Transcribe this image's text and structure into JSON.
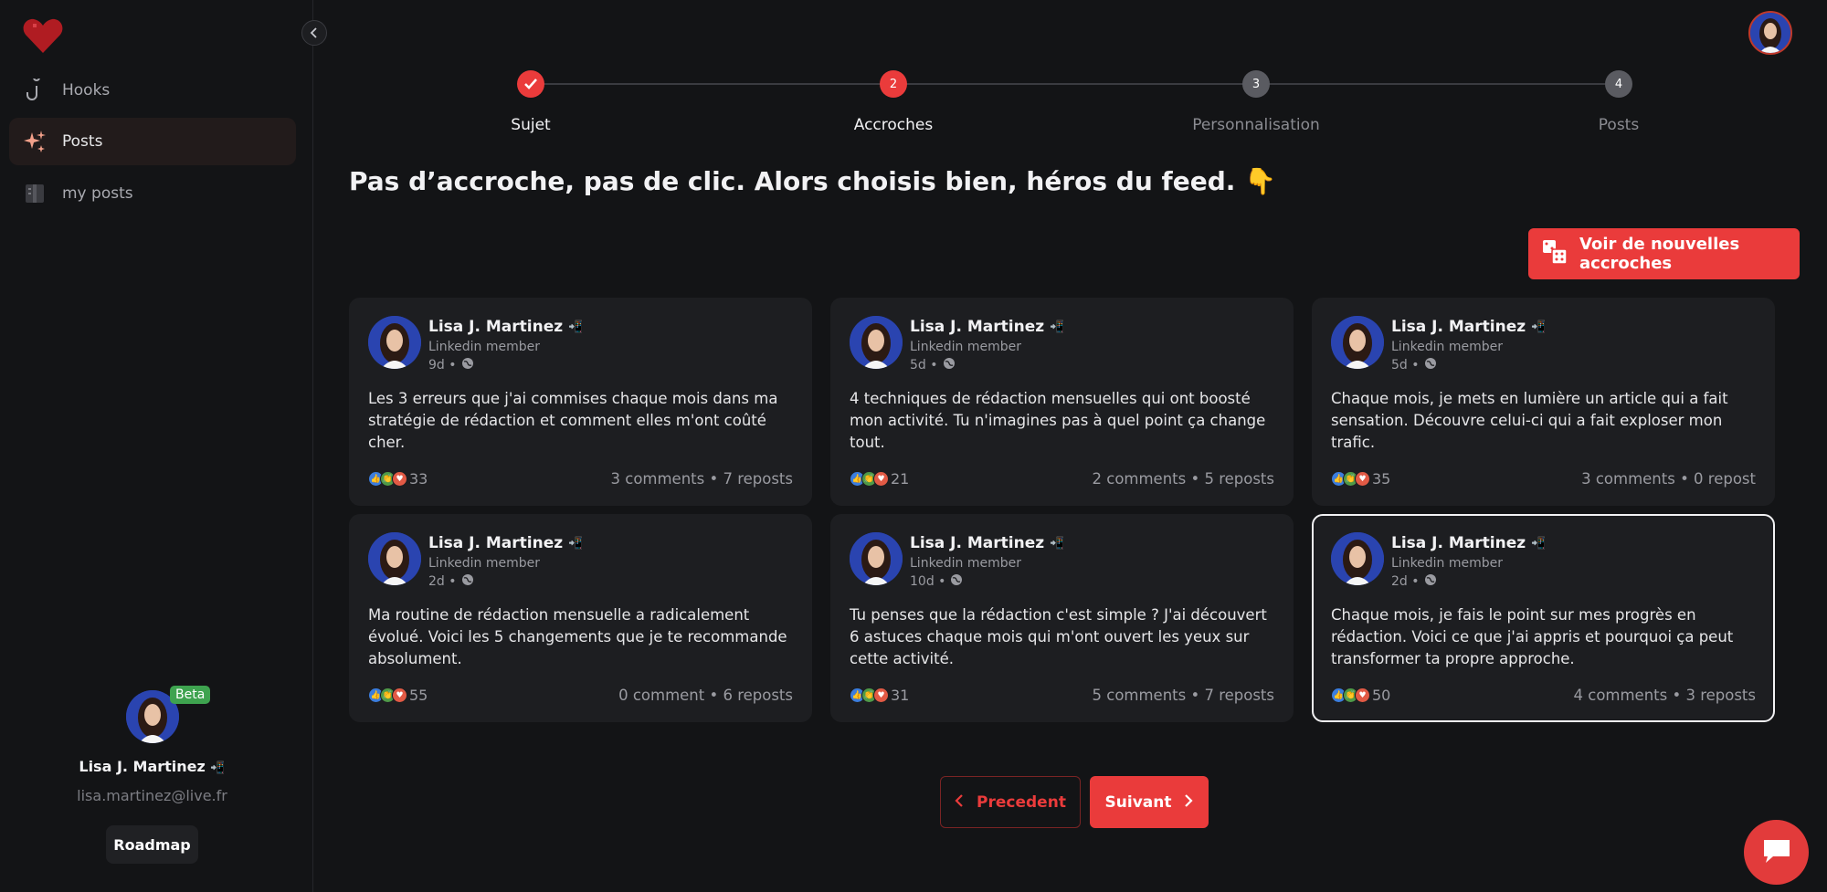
{
  "sidebar": {
    "items": [
      {
        "label": "Hooks",
        "icon": "hook-icon"
      },
      {
        "label": "Posts",
        "icon": "sparkles-icon"
      },
      {
        "label": "my posts",
        "icon": "notebook-icon"
      }
    ],
    "profile": {
      "badge": "Beta",
      "name": "Lisa J. Martinez",
      "email": "lisa.martinez@live.fr",
      "roadmap_label": "Roadmap"
    }
  },
  "stepper": {
    "steps": [
      {
        "number": "✓",
        "label": "Sujet",
        "state": "done"
      },
      {
        "number": "2",
        "label": "Accroches",
        "state": "active"
      },
      {
        "number": "3",
        "label": "Personnalisation",
        "state": "pending"
      },
      {
        "number": "4",
        "label": "Posts",
        "state": "pending"
      }
    ]
  },
  "main": {
    "title": "Pas d’accroche, pas de clic. Alors choisis bien, héros du feed. 👇",
    "new_hooks_label": "Voir de nouvelles accroches"
  },
  "posts": [
    {
      "name": "Lisa J. Martinez",
      "subtitle": "Linkedin member",
      "time": "9d •",
      "text": "Les 3 erreurs que j'ai commises chaque mois dans ma stratégie de rédaction et comment elles m'ont coûté cher.",
      "reactions": "33",
      "stats": "3 comments • 7 reposts"
    },
    {
      "name": "Lisa J. Martinez",
      "subtitle": "Linkedin member",
      "time": "5d •",
      "text": "4 techniques de rédaction mensuelles qui ont boosté mon activité. Tu n'imagines pas à quel point ça change tout.",
      "reactions": "21",
      "stats": "2 comments • 5 reposts"
    },
    {
      "name": "Lisa J. Martinez",
      "subtitle": "Linkedin member",
      "time": "5d •",
      "text": "Chaque mois, je mets en lumière un article qui a fait sensation. Découvre celui-ci qui a fait exploser mon trafic.",
      "reactions": "35",
      "stats": "3 comments • 0 repost"
    },
    {
      "name": "Lisa J. Martinez",
      "subtitle": "Linkedin member",
      "time": "2d •",
      "text": "Ma routine de rédaction mensuelle a radicalement évolué. Voici les 5 changements que je te recommande absolument.",
      "reactions": "55",
      "stats": "0 comment • 6 reposts"
    },
    {
      "name": "Lisa J. Martinez",
      "subtitle": "Linkedin member",
      "time": "10d •",
      "text": "Tu penses que la rédaction c'est simple ? J'ai découvert 6 astuces chaque mois qui m'ont ouvert les yeux sur cette activité.",
      "reactions": "31",
      "stats": "5 comments • 7 reposts"
    },
    {
      "name": "Lisa J. Martinez",
      "subtitle": "Linkedin member",
      "time": "2d •",
      "text": "Chaque mois, je fais le point sur mes progrès en rédaction. Voici ce que j'ai appris et pourquoi ça peut transformer ta propre approche.",
      "reactions": "50",
      "stats": "4 comments • 3 reposts"
    }
  ],
  "pagination": {
    "prev_label": "Precedent",
    "next_label": "Suivant"
  },
  "colors": {
    "accent": "#ea3b3b",
    "background": "#131416",
    "card": "#1d1e21"
  }
}
